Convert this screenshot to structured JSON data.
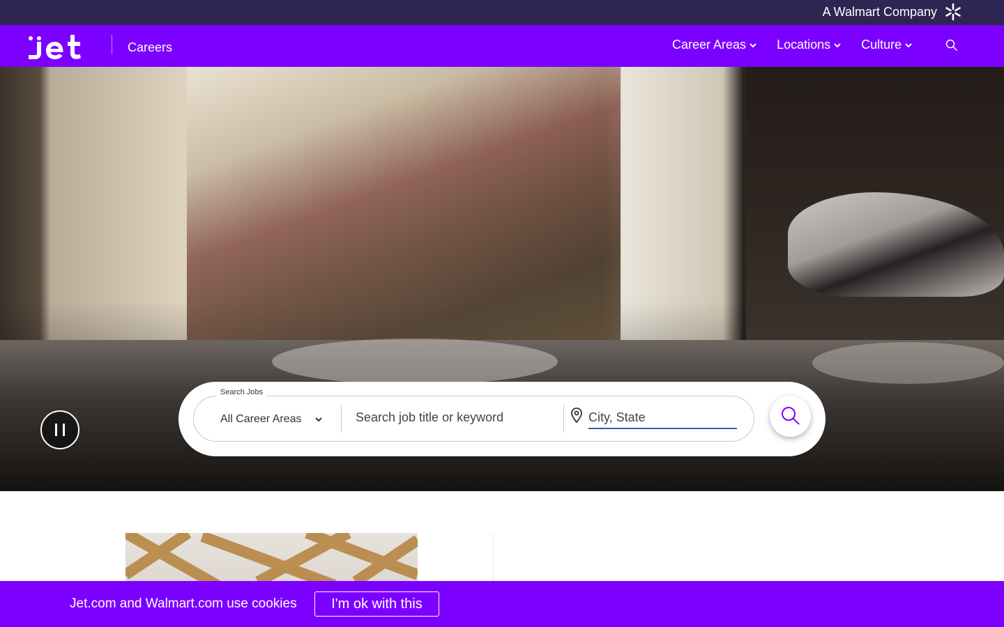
{
  "topbar": {
    "walmart_text": "A Walmart Company",
    "icon": "walmart-spark-icon"
  },
  "nav": {
    "logo_text": "jet",
    "section_title": "Careers",
    "menu": [
      {
        "label": "Career Areas"
      },
      {
        "label": "Locations"
      },
      {
        "label": "Culture"
      }
    ],
    "search_icon": "search-icon"
  },
  "hero": {
    "pause_icon": "pause-icon",
    "search": {
      "legend": "Search Jobs",
      "career_area_value": "All Career Areas",
      "keyword_placeholder": "Search job title or keyword",
      "location_placeholder": "City, State",
      "submit_icon": "search-icon"
    }
  },
  "cookie": {
    "text": "Jet.com and Walmart.com use cookies",
    "button_label": "I'm ok with this"
  },
  "colors": {
    "brand_purple": "#7b00ff",
    "topbar_navy": "#2e2552",
    "walmart_yellow": "#ffc220"
  }
}
